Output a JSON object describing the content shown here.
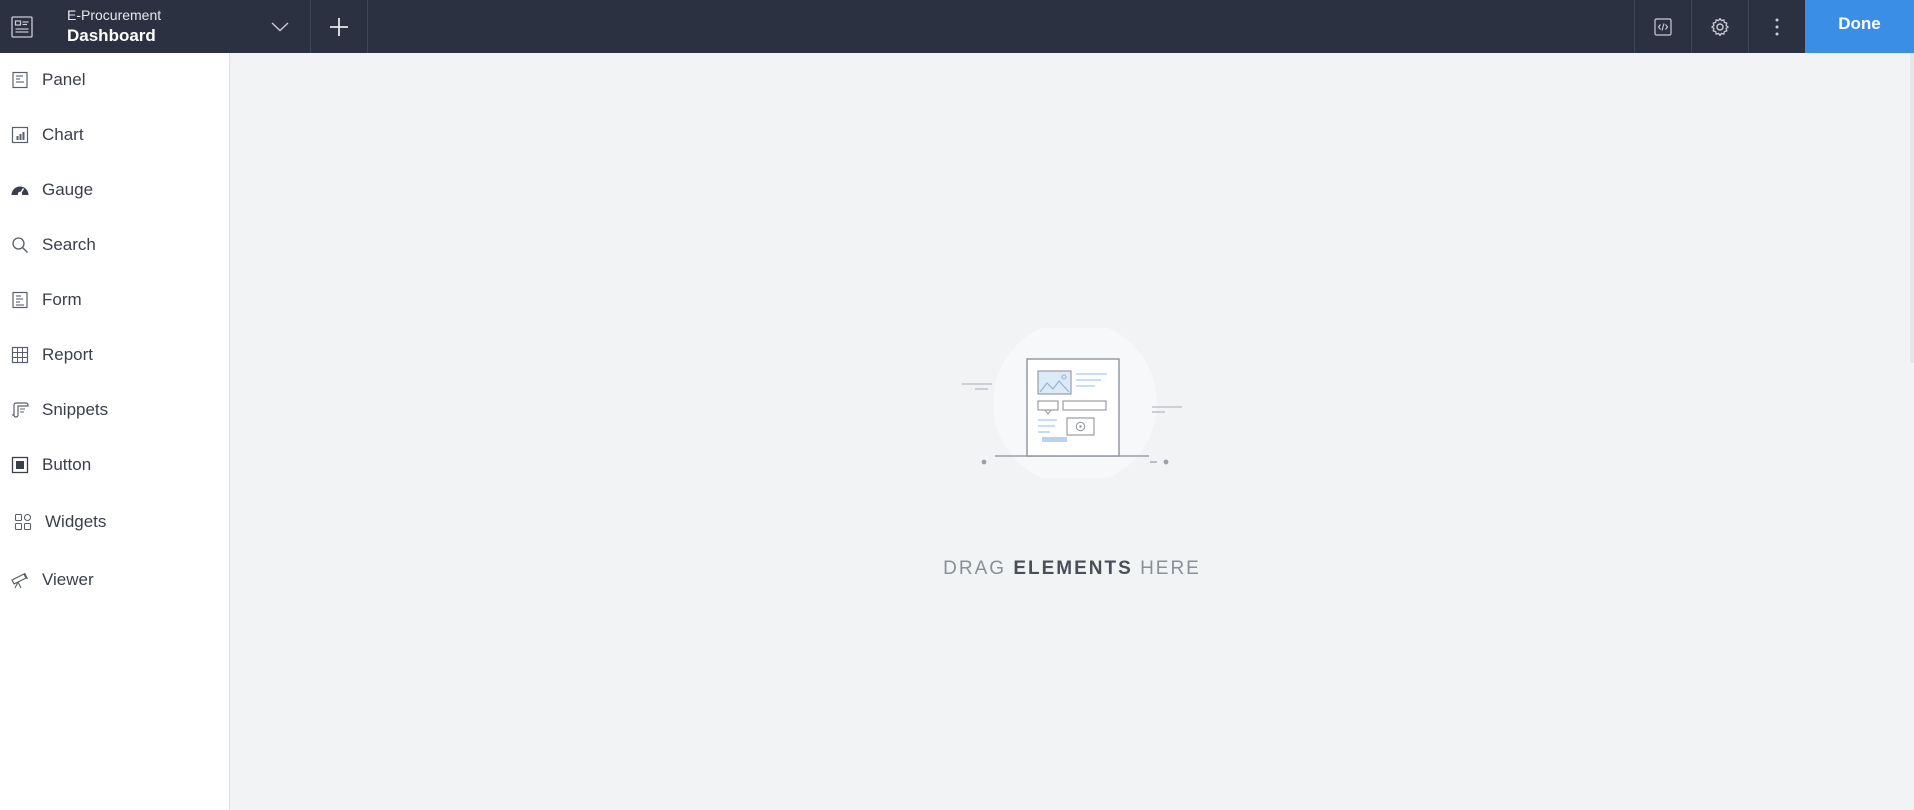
{
  "header": {
    "app_name": "E-Procurement",
    "page_name": "Dashboard",
    "done_label": "Done",
    "icons": {
      "app": "dashboard-app-icon",
      "dropdown": "chevron-down-icon",
      "add": "plus-icon",
      "code": "code-icon",
      "settings": "gear-icon",
      "more": "more-vertical-icon"
    }
  },
  "sidebar": {
    "items": [
      {
        "label": "Panel",
        "icon": "panel-icon"
      },
      {
        "label": "Chart",
        "icon": "chart-icon"
      },
      {
        "label": "Gauge",
        "icon": "gauge-icon"
      },
      {
        "label": "Search",
        "icon": "search-icon"
      },
      {
        "label": "Form",
        "icon": "form-icon"
      },
      {
        "label": "Report",
        "icon": "report-grid-icon"
      },
      {
        "label": "Snippets",
        "icon": "snippets-icon"
      },
      {
        "label": "Button",
        "icon": "button-icon"
      },
      {
        "label": "Widgets",
        "icon": "widgets-icon"
      },
      {
        "label": "Viewer",
        "icon": "telescope-icon"
      }
    ]
  },
  "canvas": {
    "drop_text_pre": "DRAG",
    "drop_text_strong": "ELEMENTS",
    "drop_text_post": "HERE"
  },
  "colors": {
    "topbar": "#2b3140",
    "accent": "#3a8ee6",
    "canvas_bg": "#f2f3f5"
  }
}
